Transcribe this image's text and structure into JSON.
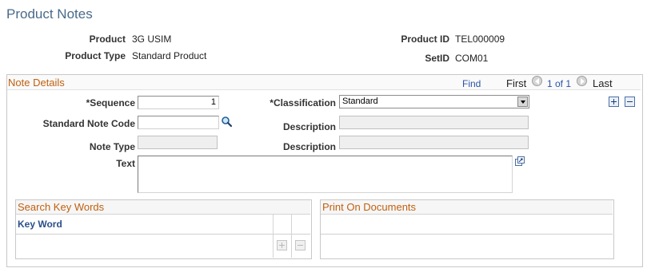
{
  "page": {
    "title": "Product Notes"
  },
  "header": {
    "product_label": "Product",
    "product_value": "3G USIM",
    "product_type_label": "Product Type",
    "product_type_value": "Standard Product",
    "product_id_label": "Product ID",
    "product_id_value": "TEL000009",
    "setid_label": "SetID",
    "setid_value": "COM01"
  },
  "note_details": {
    "section_title": "Note Details",
    "find_label": "Find",
    "first_label": "First",
    "page_indicator": "1 of 1",
    "last_label": "Last",
    "sequence_label": "*Sequence",
    "sequence_value": "1",
    "classification_label": "*Classification",
    "classification_value": "Standard",
    "standard_note_code_label": "Standard Note Code",
    "standard_note_code_value": "",
    "description1_label": "Description",
    "description1_value": "",
    "note_type_label": "Note Type",
    "note_type_value": "",
    "description2_label": "Description",
    "description2_value": "",
    "text_label": "Text",
    "text_value": ""
  },
  "search_key_words": {
    "title": "Search Key Words",
    "column_header": "Key Word"
  },
  "print_on_documents": {
    "title": "Print On Documents"
  }
}
